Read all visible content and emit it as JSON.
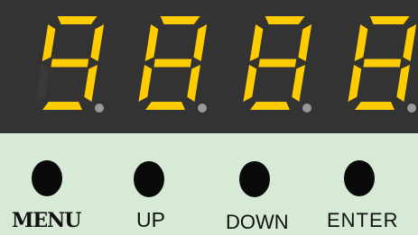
{
  "display": {
    "digits": [
      {
        "char": "9",
        "dot": false
      },
      {
        "char": "8",
        "dot": false
      },
      {
        "char": "8",
        "dot": false
      },
      {
        "char": "8",
        "dot": false
      }
    ],
    "segment_color_on": "#ffcc00",
    "segment_color_off": "#3a3a3a",
    "dot_color": "#9a9a9a",
    "background_color": "#333333"
  },
  "buttons": {
    "menu": {
      "label": "MENU"
    },
    "up": {
      "label": "UP"
    },
    "down": {
      "label": "DOWN"
    },
    "enter": {
      "label": "ENTER"
    }
  },
  "panel": {
    "background_color": "#d6ead6"
  }
}
